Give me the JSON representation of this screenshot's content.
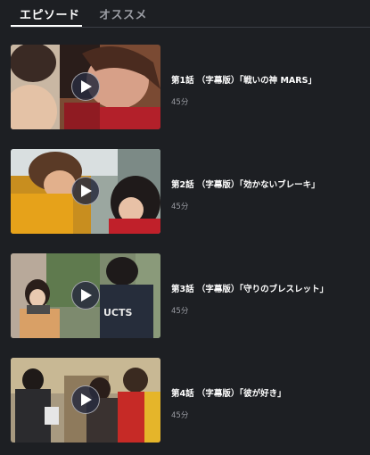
{
  "tabs": [
    {
      "label": "エピソード",
      "active": true
    },
    {
      "label": "オススメ",
      "active": false
    }
  ],
  "episodes": [
    {
      "title": "第1話 （字幕版）「戦いの神 MARS」",
      "duration": "45分"
    },
    {
      "title": "第2話 （字幕版）「効かないブレーキ」",
      "duration": "45分"
    },
    {
      "title": "第3話 （字幕版）「守りのブレスレット」",
      "duration": "45分"
    },
    {
      "title": "第4話 （字幕版）「彼が好き」",
      "duration": "45分"
    }
  ],
  "icons": {
    "play": "play-icon"
  },
  "colors": {
    "background": "#1d1f23",
    "text_primary": "#ffffff",
    "text_secondary": "#9a9ca3"
  }
}
